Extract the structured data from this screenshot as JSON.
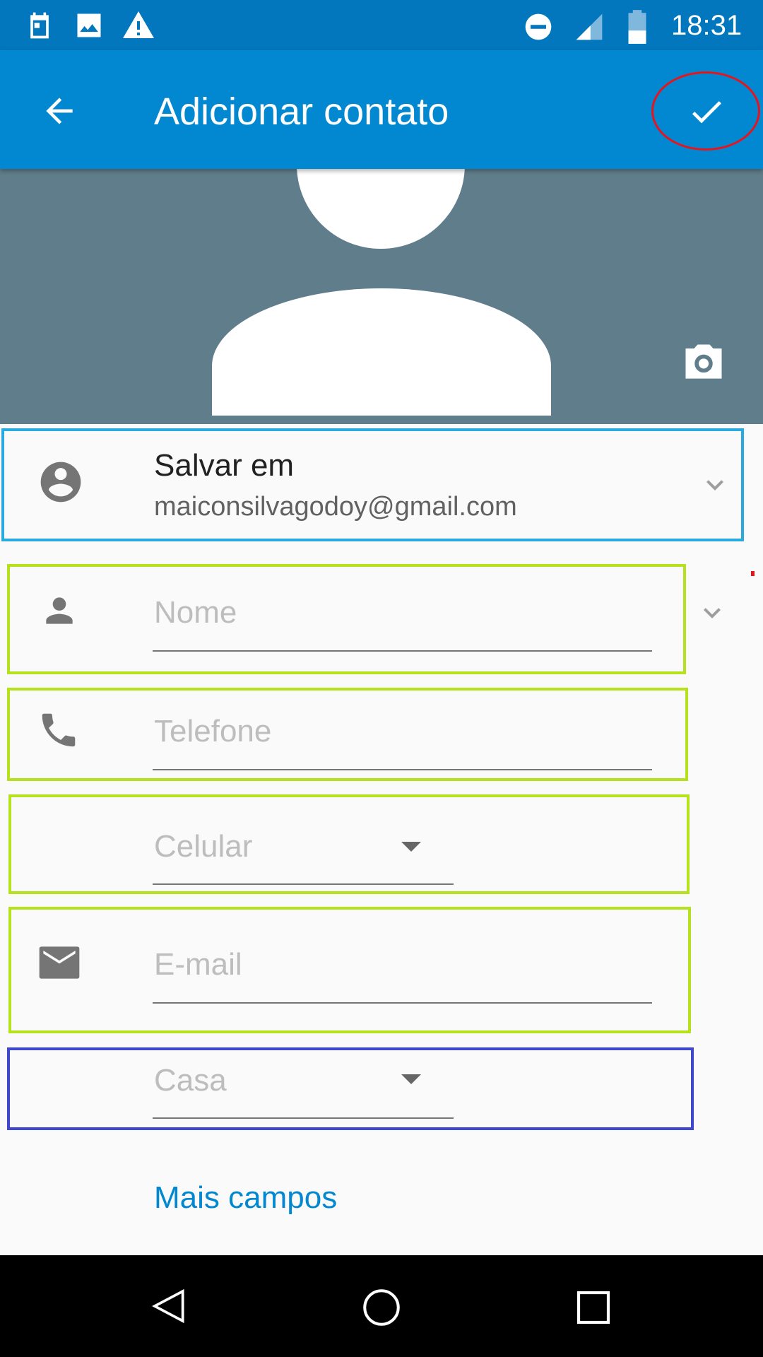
{
  "status_bar": {
    "time": "18:31",
    "icons": [
      "calendar-icon",
      "image-icon",
      "warning-icon",
      "do-not-disturb-icon",
      "signal-icon",
      "battery-icon"
    ]
  },
  "toolbar": {
    "title": "Adicionar contato",
    "back_icon": "arrow-back-icon",
    "save_icon": "check-icon"
  },
  "account": {
    "label": "Salvar em",
    "email": "maiconsilvagodoy@gmail.com"
  },
  "fields": {
    "name_placeholder": "Nome",
    "phone_placeholder": "Telefone",
    "phone_type": "Celular",
    "email_placeholder": "E-mail",
    "email_type": "Casa"
  },
  "more_fields": "Mais campos",
  "colors": {
    "primary": "#0288d1",
    "status": "#0277bd",
    "photo_bg": "#607d8b",
    "highlight_green": "#b5e21c",
    "highlight_blue": "#29a9e0",
    "highlight_violet": "#3f48cc",
    "annotation_red": "#e8141c"
  }
}
